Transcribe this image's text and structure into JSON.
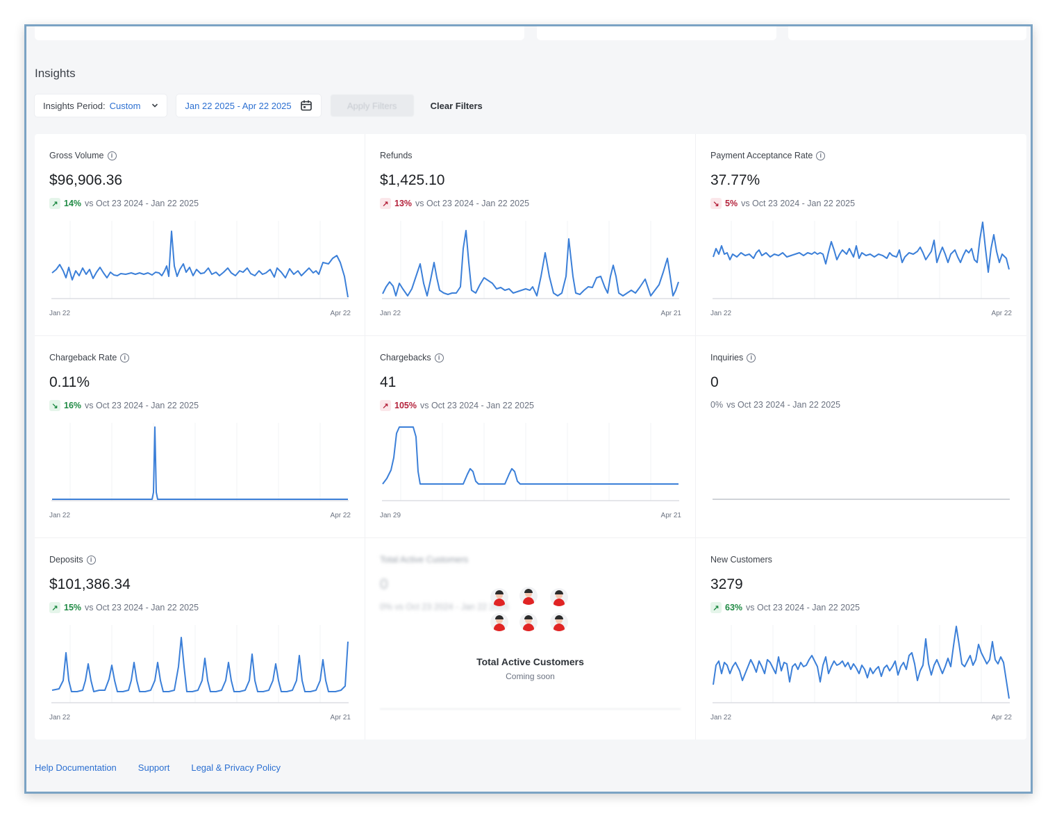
{
  "page": {
    "title": "Insights",
    "filters": {
      "period_label": "Insights Period:",
      "period_value": "Custom",
      "date_range": "Jan 22 2025 - Apr 22 2025",
      "apply_label": "Apply Filters",
      "clear_label": "Clear Filters"
    }
  },
  "cards": [
    {
      "label": "Gross Volume",
      "value": "$96,906.36",
      "delta_pct": "14%",
      "delta_text": "vs Oct 23 2024 - Jan 22 2025",
      "tick_start": "Jan 22",
      "tick_end": "Apr 22"
    },
    {
      "label": "Refunds",
      "value": "$1,425.10",
      "delta_pct": "13%",
      "delta_text": "vs Oct 23 2024 - Jan 22 2025",
      "tick_start": "Jan 22",
      "tick_end": "Apr 21"
    },
    {
      "label": "Payment Acceptance Rate",
      "value": "37.77%",
      "delta_pct": "5%",
      "delta_text": "vs Oct 23 2024 - Jan 22 2025",
      "tick_start": "Jan 22",
      "tick_end": "Apr 22"
    },
    {
      "label": "Chargeback Rate",
      "value": "0.11%",
      "delta_pct": "16%",
      "delta_text": "vs Oct 23 2024 - Jan 22 2025",
      "tick_start": "Jan 22",
      "tick_end": "Apr 22"
    },
    {
      "label": "Chargebacks",
      "value": "41",
      "delta_pct": "105%",
      "delta_text": "vs Oct 23 2024 - Jan 22 2025",
      "tick_start": "Jan 29",
      "tick_end": "Apr 21"
    },
    {
      "label": "Inquiries",
      "value": "0",
      "delta_pct": "0%",
      "delta_text": "vs Oct 23 2024 - Jan 22 2025"
    },
    {
      "label": "Deposits",
      "value": "$101,386.34",
      "delta_pct": "15%",
      "delta_text": "vs Oct 23 2024 - Jan 22 2025",
      "tick_start": "Jan 22",
      "tick_end": "Apr 21"
    },
    {
      "label": "Total Active Customers",
      "value": "0",
      "delta_text": "0% vs Oct 23 2024 - Jan 22 2025",
      "coming_title": "Total Active Customers",
      "coming_sub": "Coming soon"
    },
    {
      "label": "New Customers",
      "value": "3279",
      "delta_pct": "63%",
      "delta_text": "vs Oct 23 2024 - Jan 22 2025",
      "tick_start": "Jan 22",
      "tick_end": "Apr 22"
    }
  ],
  "footer": {
    "help": "Help Documentation",
    "support": "Support",
    "legal": "Legal & Privacy Policy"
  },
  "colors": {
    "accent": "#2b6fd1",
    "line": "#3b7fd8",
    "positive": "#1f8a44",
    "negative": "#b4233c"
  },
  "icons": {
    "info": "info-circle-icon",
    "calendar": "calendar-icon",
    "chevron": "chevron-down-icon",
    "arrow_up": "arrow-up-right-icon",
    "arrow_down": "arrow-down-right-icon"
  }
}
